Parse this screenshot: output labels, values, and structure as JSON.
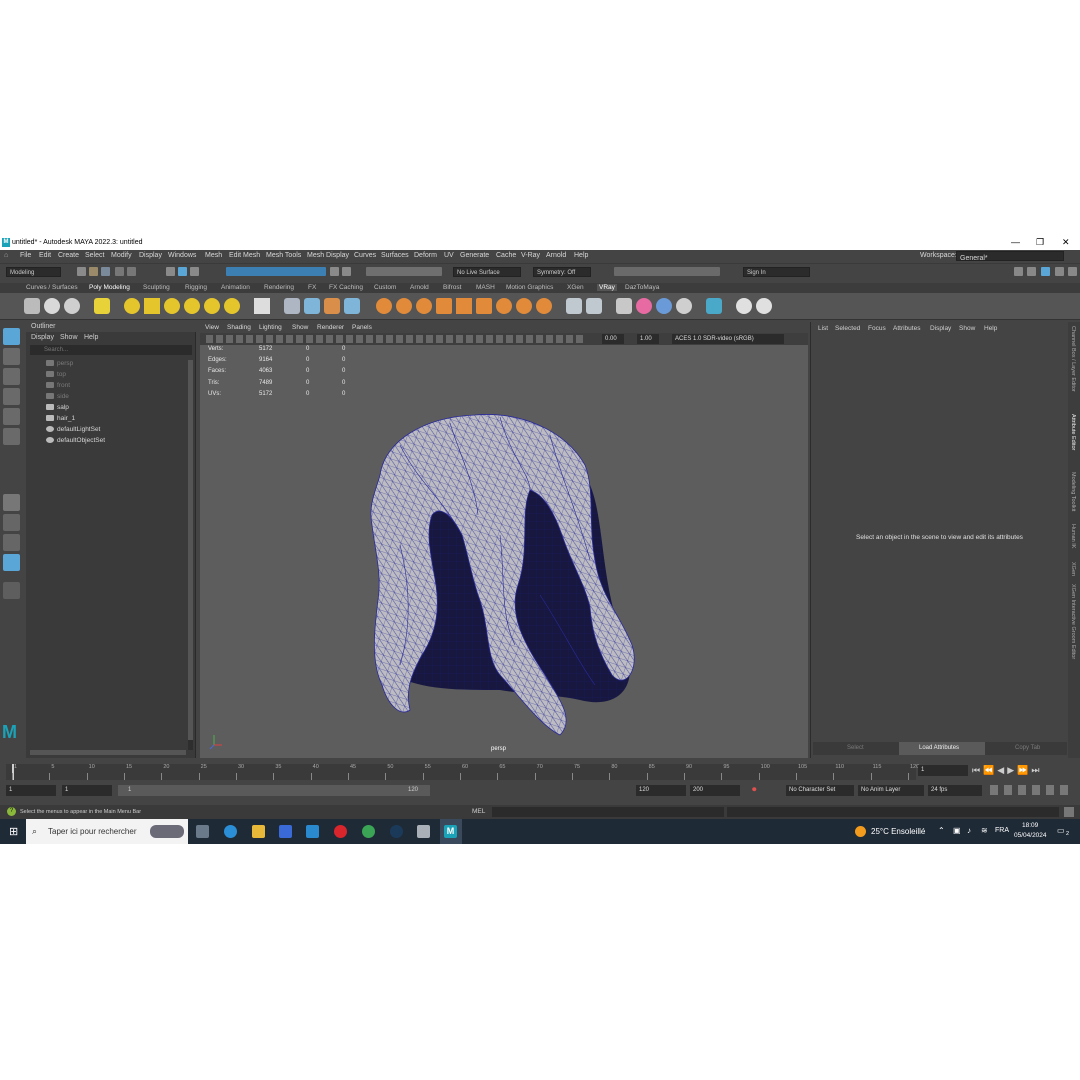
{
  "window": {
    "title": "untitled* - Autodesk MAYA 2022.3: untitled",
    "logo_letter": "M",
    "controls": [
      "—",
      "❐",
      "✕"
    ]
  },
  "menubar": {
    "items": [
      "File",
      "Edit",
      "Create",
      "Select",
      "Modify",
      "Display",
      "Windows",
      "Mesh",
      "Edit Mesh",
      "Mesh Tools",
      "Mesh Display",
      "Curves",
      "Surfaces",
      "Deform",
      "UV",
      "Generate",
      "Cache",
      "V-Ray",
      "Arnold",
      "Help"
    ],
    "workspace_label": "Workspace:",
    "workspace_value": "General*"
  },
  "toolbar": {
    "mode": "Modeling",
    "live_surface": "No Live Surface",
    "symmetry": "Symmetry: Off",
    "sign_in": "Sign In"
  },
  "shelf": {
    "tabs": [
      "Curves / Surfaces",
      "Poly Modeling",
      "Sculpting",
      "Rigging",
      "Animation",
      "Rendering",
      "FX",
      "FX Caching",
      "Custom",
      "Arnold",
      "Bifrost",
      "MASH",
      "Motion Graphics",
      "XGen",
      "VRay",
      "DazToMaya"
    ],
    "active_tab": "VRay"
  },
  "outliner": {
    "title": "Outliner",
    "menu": [
      "Display",
      "Show",
      "Help"
    ],
    "search_placeholder": "Search...",
    "items": [
      {
        "label": "persp",
        "dim": true,
        "icon": "camera-icon"
      },
      {
        "label": "top",
        "dim": true,
        "icon": "camera-icon"
      },
      {
        "label": "front",
        "dim": true,
        "icon": "camera-icon"
      },
      {
        "label": "side",
        "dim": true,
        "icon": "camera-icon"
      },
      {
        "label": "salp",
        "dim": false,
        "icon": "mesh-icon"
      },
      {
        "label": "hair_1",
        "dim": false,
        "icon": "mesh-icon"
      },
      {
        "label": "defaultLightSet",
        "dim": false,
        "icon": "set-icon"
      },
      {
        "label": "defaultObjectSet",
        "dim": false,
        "icon": "set-icon"
      }
    ]
  },
  "viewport": {
    "menu": [
      "View",
      "Shading",
      "Lighting",
      "Show",
      "Renderer",
      "Panels"
    ],
    "exposure": "0.00",
    "gamma": "1.00",
    "color_space": "ACES 1.0 SDR-video (sRGB)",
    "camera_label": "persp",
    "hud": [
      {
        "label": "Verts:",
        "v1": "5172",
        "v2": "0",
        "v3": "0"
      },
      {
        "label": "Edges:",
        "v1": "9164",
        "v2": "0",
        "v3": "0"
      },
      {
        "label": "Faces:",
        "v1": "4063",
        "v2": "0",
        "v3": "0"
      },
      {
        "label": "Tris:",
        "v1": "7489",
        "v2": "0",
        "v3": "0"
      },
      {
        "label": "UVs:",
        "v1": "5172",
        "v2": "0",
        "v3": "0"
      }
    ]
  },
  "attribute_editor": {
    "menu": [
      "List",
      "Selected",
      "Focus",
      "Attributes",
      "Display",
      "Show",
      "Help"
    ],
    "message": "Select an object in the scene to view and edit its attributes",
    "buttons": [
      "Select",
      "Load Attributes",
      "Copy Tab"
    ]
  },
  "side_tabs": [
    "Channel Box / Layer Editor",
    "Attribute Editor",
    "Modeling Toolkit",
    "Human IK",
    "XGen",
    "XGen Interactive Groom Editor"
  ],
  "timeline": {
    "ticks": [
      "1",
      "5",
      "10",
      "15",
      "20",
      "25",
      "30",
      "35",
      "40",
      "45",
      "50",
      "55",
      "60",
      "65",
      "70",
      "75",
      "80",
      "85",
      "90",
      "95",
      "100",
      "105",
      "110",
      "115",
      "120"
    ],
    "current_frame": "1"
  },
  "range": {
    "start": "1",
    "inner_start": "1",
    "slider_start": "1",
    "slider_end": "120",
    "end": "120",
    "outer_end": "200",
    "character_set": "No Character Set",
    "anim_layer": "No Anim Layer",
    "fps": "24 fps"
  },
  "commandline": {
    "help_text": "Select the menus to appear in the Main Menu Bar",
    "lang": "MEL"
  },
  "taskbar": {
    "search_placeholder": "Taper ici pour rechercher",
    "weather": "25°C  Ensoleillé",
    "lang": "FRA",
    "time": "18:09",
    "date": "05/04/2024",
    "notif_count": "2"
  },
  "colors": {
    "panel": "#444444",
    "viewport_bg": "#5d5d5d",
    "accent": "#5aa6d6",
    "wire": "#2a2a9a",
    "taskbar": "#1f2a37"
  }
}
